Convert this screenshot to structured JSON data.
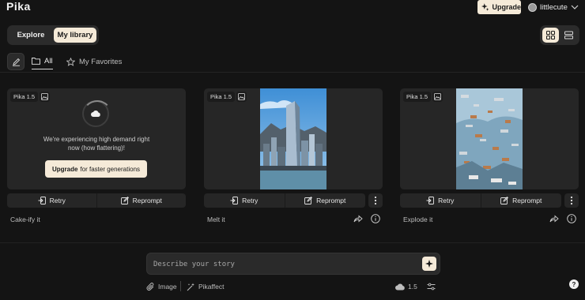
{
  "header": {
    "logo": "Pika",
    "upgrade_label": "Upgrade",
    "username": "littlecute"
  },
  "tabs": {
    "explore": "Explore",
    "library": "My library",
    "active": "My library"
  },
  "view_modes": [
    "grid-view-icon",
    "list-view-icon"
  ],
  "filters": {
    "all": "All",
    "favorites": "My Favorites",
    "active": "All"
  },
  "cards": [
    {
      "model": "Pika 1.5",
      "status": "pending",
      "demand_text": "We're experiencing high demand right now (how flattering)!",
      "upgrade_strong": "Upgrade",
      "upgrade_rest": "for faster generations",
      "retry": "Retry",
      "reprompt": "Reprompt",
      "title": "Cake-ify it"
    },
    {
      "model": "Pika 1.5",
      "status": "done",
      "retry": "Retry",
      "reprompt": "Reprompt",
      "title": "Melt it"
    },
    {
      "model": "Pika 1.5",
      "status": "done",
      "retry": "Retry",
      "reprompt": "Reprompt",
      "title": "Explode it"
    }
  ],
  "prompt": {
    "placeholder": "Describe your story"
  },
  "bottom_bar": {
    "image": "Image",
    "pikaffect": "Pikaffect",
    "model": "1.5"
  },
  "help": "?",
  "colors": {
    "background": "#141414",
    "card": "#262626",
    "accent": "#f5ead8"
  }
}
